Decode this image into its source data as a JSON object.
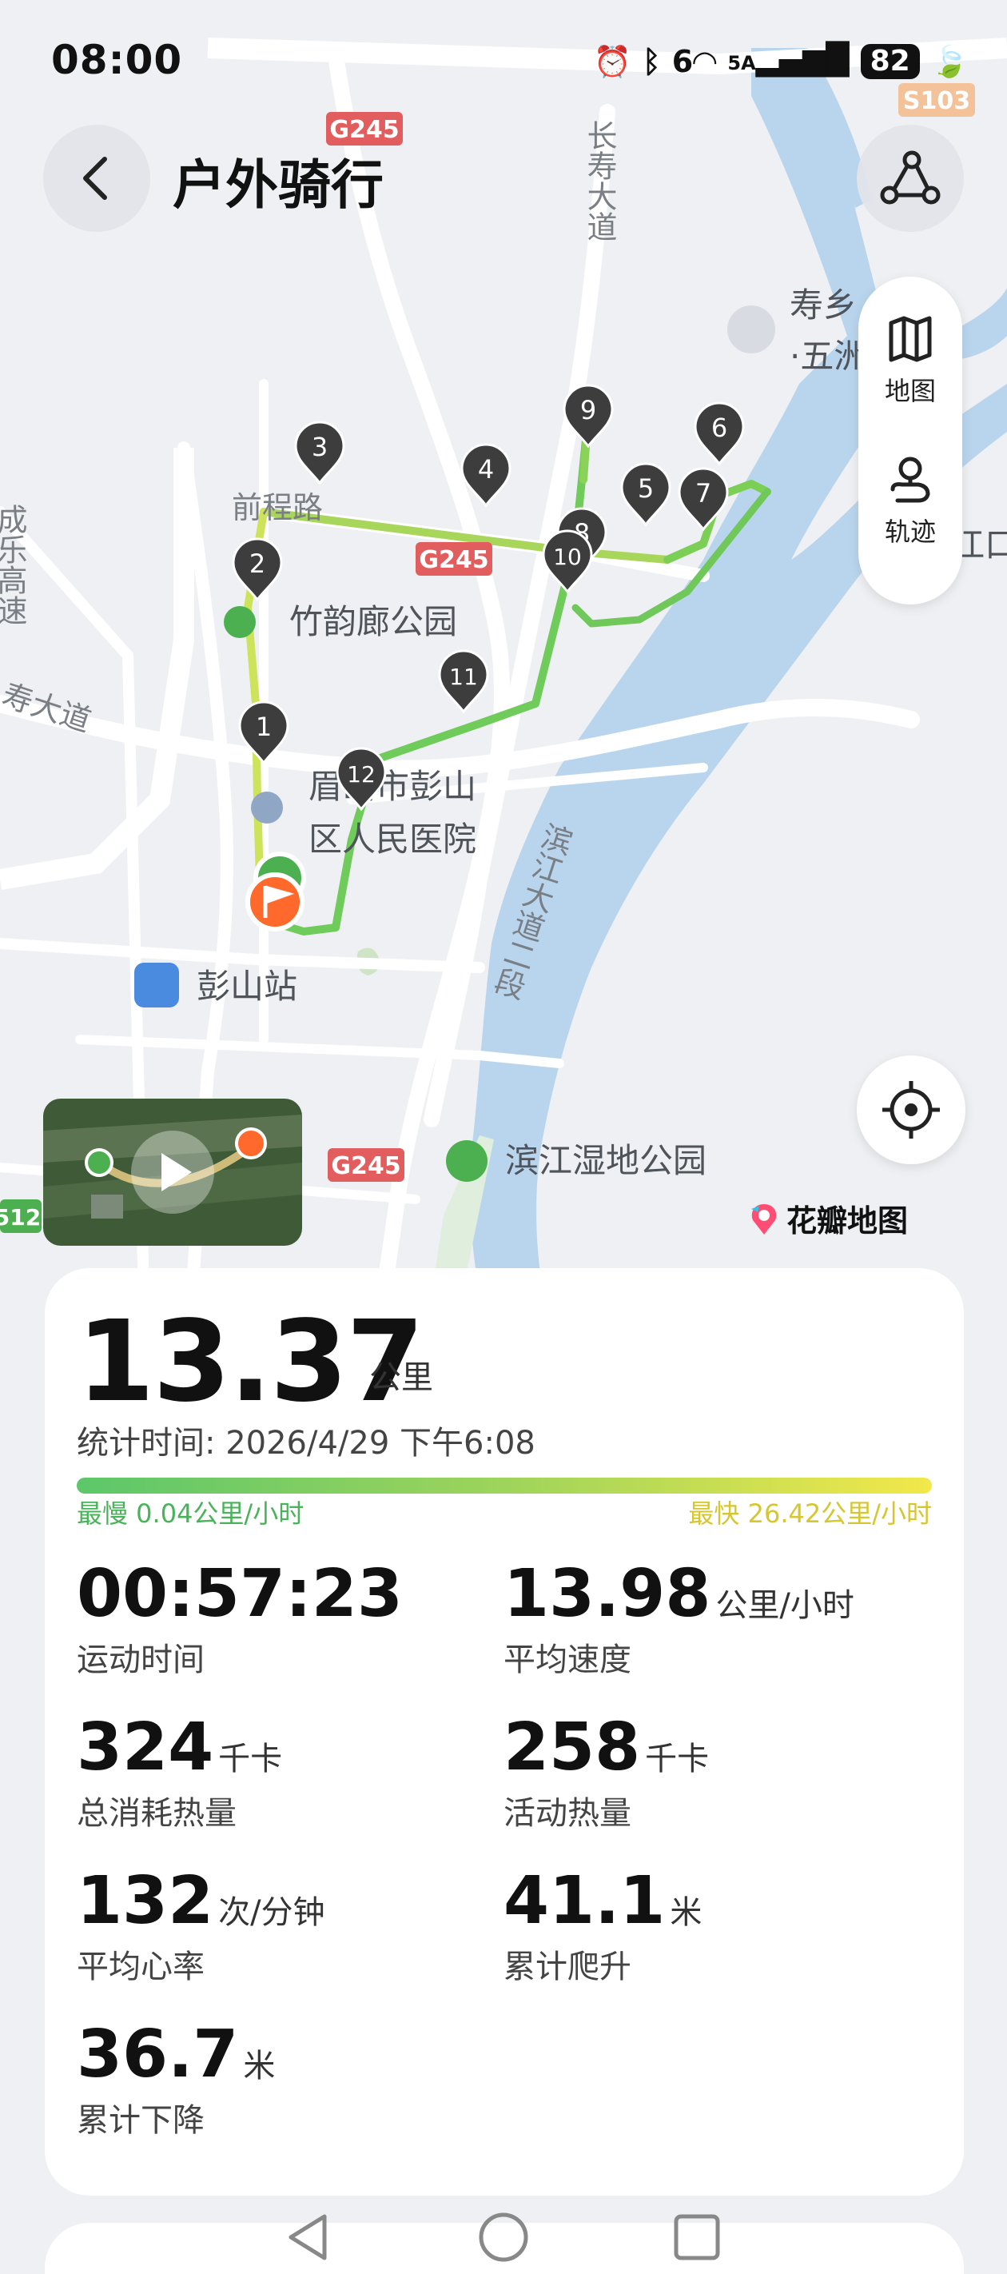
{
  "status_bar": {
    "time": "08:00",
    "signal_label": "5A",
    "wifi_label": "6",
    "battery": "82"
  },
  "header": {
    "title": "户外骑行"
  },
  "map": {
    "road_labels": {
      "g245_top": "G245",
      "g245_mid": "G245",
      "g245_bottom": "G245",
      "s103": "S103",
      "s512": "512",
      "changshou": "长寿大道",
      "qiancheng": "前程路",
      "chengle": "成乐高速",
      "binjiang": "滨江大道二段",
      "road_left": "寿大道"
    },
    "poi_labels": {
      "park": "竹韵廊公园",
      "hospital_1": "眉山市彭山",
      "hospital_2": "区人民医院",
      "station": "彭山站",
      "wetland": "滨江湿地公园",
      "shouxiang_1": "寿乡",
      "shouxiang_2": "·五洲",
      "jiangkou": "江口"
    },
    "markers": [
      "1",
      "2",
      "3",
      "4",
      "5",
      "6",
      "7",
      "8",
      "9",
      "10",
      "11",
      "12"
    ],
    "side_panel": {
      "map_label": "地图",
      "track_label": "轨迹"
    },
    "brand": "花瓣地图"
  },
  "stats": {
    "distance": "13.37",
    "distance_unit": "公里",
    "time_label": "统计时间:",
    "time_value": "2026/4/29 下午6:08",
    "slowest": "最慢 0.04公里/小时",
    "fastest": "最快 26.42公里/小时",
    "metrics": [
      {
        "value": "00:57:23",
        "unit": "",
        "label": "运动时间"
      },
      {
        "value": "13.98",
        "unit": "公里/小时",
        "label": "平均速度"
      },
      {
        "value": "324",
        "unit": "千卡",
        "label": "总消耗热量"
      },
      {
        "value": "258",
        "unit": "千卡",
        "label": "活动热量"
      },
      {
        "value": "132",
        "unit": "次/分钟",
        "label": "平均心率"
      },
      {
        "value": "41.1",
        "unit": "米",
        "label": "累计爬升"
      },
      {
        "value": "36.7",
        "unit": "米",
        "label": "累计下降"
      }
    ]
  },
  "colors": {
    "accent": "#4caf50",
    "route": "#7ccf55",
    "water": "#b9d5ee",
    "marker": "#3d3d3d",
    "flag": "#ff6a2c"
  }
}
